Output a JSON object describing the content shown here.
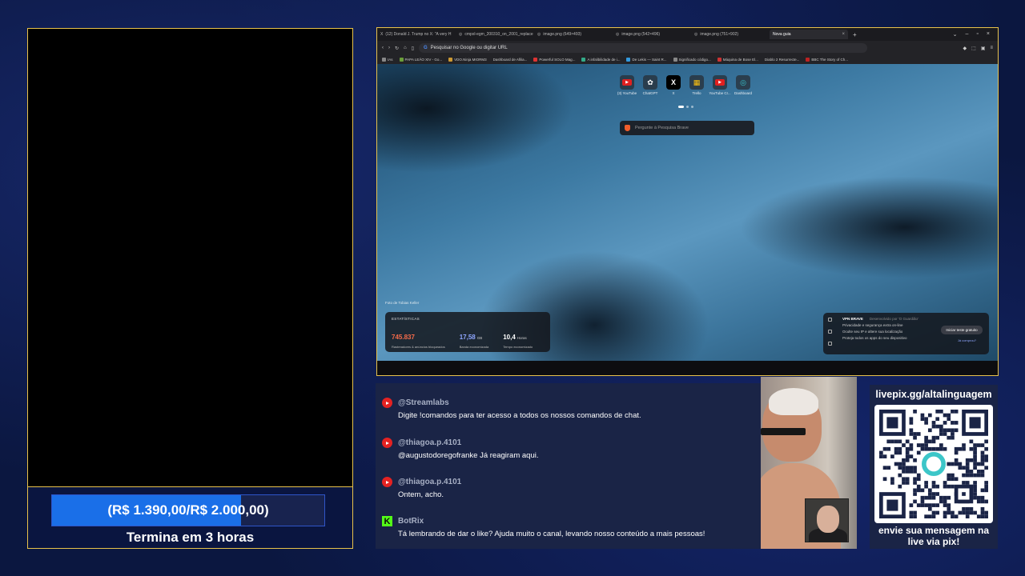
{
  "goal": {
    "text": "(R$ 1.390,00/R$ 2.000,00)",
    "progress_fraction": 0.695,
    "subtitle": "Termina em 3 horas"
  },
  "browser": {
    "tabs": [
      {
        "label": "(12) Donald J. Trump no X: \"A very H",
        "active": false
      },
      {
        "label": "cmpxl-egm_200310_on_2001_replace",
        "active": false
      },
      {
        "label": "image.png (649×493)",
        "active": false
      },
      {
        "label": "image.png (542×496)",
        "active": false
      },
      {
        "label": "image.png (751×902)",
        "active": false
      },
      {
        "label": "Nova guia",
        "active": true
      }
    ],
    "url_placeholder": "Pesquisar no Google ou digitar URL",
    "bookmarks": [
      "IAs",
      "PAPA LEÃO XIV - Go...",
      "VDO.Ninja MIORM3",
      "Dashboard de Afilia...",
      "Powerful SOLO Mag...",
      "A infalibilidade de i...",
      "De Lekis — Saint R...",
      "Significado código...",
      "Máquina de Bose El...",
      "Diablo 2 Resurrecte...",
      "BBC The Story of Ch..."
    ],
    "shortcuts": [
      {
        "label": "(3) YouTube",
        "icon": "youtube-icon"
      },
      {
        "label": "ChatGPT",
        "icon": "chatgpt-icon"
      },
      {
        "label": "X",
        "icon": "x-icon"
      },
      {
        "label": "Trello",
        "icon": "trello-icon"
      },
      {
        "label": "YouTube Cr...",
        "icon": "youtube-icon"
      },
      {
        "label": "Dashboard",
        "icon": "dashboard-icon"
      }
    ],
    "search_placeholder": "Pergunte à Pesquisa Brave",
    "photo_credit": "Foto de Tobias Keller",
    "stats": {
      "title": "ESTATÍSTICAS",
      "blocked_value": "745.837",
      "blocked_label": "Rastreadores & anúncios bloqueados",
      "bandwidth_value": "17,58",
      "bandwidth_unit": "GB",
      "bandwidth_label": "Banda economizada",
      "time_value": "10,4",
      "time_unit": "Horas",
      "time_label": "Tempo economizado",
      "blocked_color": "#f56b4a",
      "bandwidth_color": "#8fa6ff"
    },
    "vpn": {
      "title": "VPN BRAVE",
      "subtitle": "Desenvolvido por 'O Guardião'",
      "line1": "Privacidade e segurança extra on-line",
      "line2": "Oculte seu IP e altere sua localização",
      "line3": "Proteja todos os apps do seu dispositivo",
      "button": "Iniciar teste gratuito",
      "link": "Já comprou?"
    }
  },
  "chat": {
    "messages": [
      {
        "platform": "youtube",
        "user": "@Streamlabs",
        "text": "Digite !comandos para ter acesso a todos os nossos comandos de chat."
      },
      {
        "platform": "youtube",
        "user": "@thiagoa.p.4101",
        "text": "@augustodoregofranke Já reagiram aqui."
      },
      {
        "platform": "youtube",
        "user": "@thiagoa.p.4101",
        "text": "Ontem, acho."
      },
      {
        "platform": "kick",
        "user": "BotRix",
        "text": "Tá lembrando de dar o like? Ajuda muito o canal, levando nosso conteúdo a mais pessoas!"
      }
    ]
  },
  "qr": {
    "top_text": "livepix.gg/altalinguagem",
    "bottom_text_1": "envie sua mensagem na",
    "bottom_text_2": "live via pix!"
  }
}
